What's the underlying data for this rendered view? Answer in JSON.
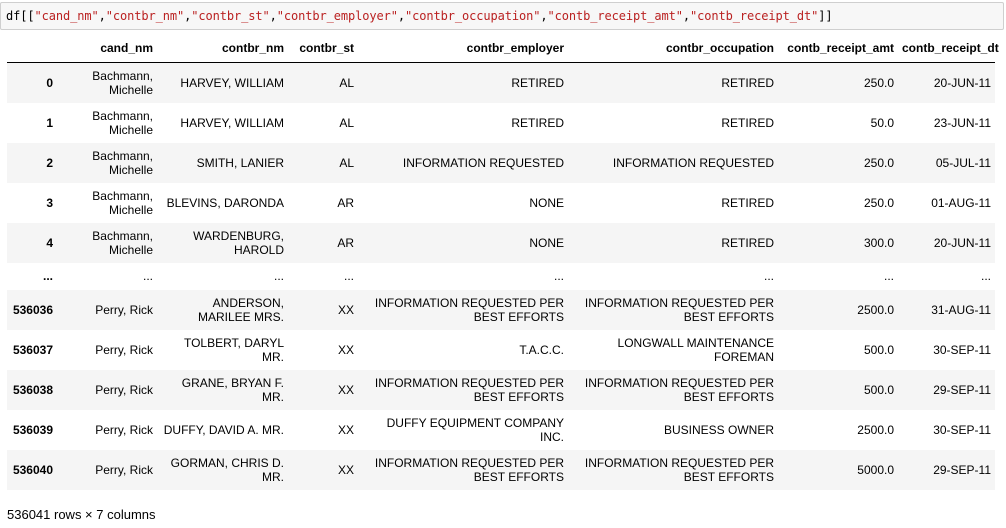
{
  "code": {
    "prefix": "df[[",
    "columns": [
      "\"cand_nm\"",
      "\"contbr_nm\"",
      "\"contbr_st\"",
      "\"contbr_employer\"",
      "\"contbr_occupation\"",
      "\"contb_receipt_amt\"",
      "\"contb_receipt_dt\""
    ],
    "separator": ",",
    "suffix": "]]"
  },
  "table": {
    "index_header": "",
    "headers": [
      "cand_nm",
      "contbr_nm",
      "contbr_st",
      "contbr_employer",
      "contbr_occupation",
      "contb_receipt_amt",
      "contb_receipt_dt"
    ],
    "rows": [
      {
        "index": "0",
        "cells": [
          "Bachmann, Michelle",
          "HARVEY, WILLIAM",
          "AL",
          "RETIRED",
          "RETIRED",
          "250.0",
          "20-JUN-11"
        ]
      },
      {
        "index": "1",
        "cells": [
          "Bachmann, Michelle",
          "HARVEY, WILLIAM",
          "AL",
          "RETIRED",
          "RETIRED",
          "50.0",
          "23-JUN-11"
        ]
      },
      {
        "index": "2",
        "cells": [
          "Bachmann, Michelle",
          "SMITH, LANIER",
          "AL",
          "INFORMATION REQUESTED",
          "INFORMATION REQUESTED",
          "250.0",
          "05-JUL-11"
        ]
      },
      {
        "index": "3",
        "cells": [
          "Bachmann, Michelle",
          "BLEVINS, DARONDA",
          "AR",
          "NONE",
          "RETIRED",
          "250.0",
          "01-AUG-11"
        ]
      },
      {
        "index": "4",
        "cells": [
          "Bachmann, Michelle",
          "WARDENBURG, HAROLD",
          "AR",
          "NONE",
          "RETIRED",
          "300.0",
          "20-JUN-11"
        ]
      },
      {
        "index": "...",
        "cells": [
          "...",
          "...",
          "...",
          "...",
          "...",
          "...",
          "..."
        ],
        "ellipsis": true
      },
      {
        "index": "536036",
        "cells": [
          "Perry, Rick",
          "ANDERSON, MARILEE MRS.",
          "XX",
          "INFORMATION REQUESTED PER BEST EFFORTS",
          "INFORMATION REQUESTED PER BEST EFFORTS",
          "2500.0",
          "31-AUG-11"
        ]
      },
      {
        "index": "536037",
        "cells": [
          "Perry, Rick",
          "TOLBERT, DARYL MR.",
          "XX",
          "T.A.C.C.",
          "LONGWALL MAINTENANCE FOREMAN",
          "500.0",
          "30-SEP-11"
        ]
      },
      {
        "index": "536038",
        "cells": [
          "Perry, Rick",
          "GRANE, BRYAN F. MR.",
          "XX",
          "INFORMATION REQUESTED PER BEST EFFORTS",
          "INFORMATION REQUESTED PER BEST EFFORTS",
          "500.0",
          "29-SEP-11"
        ]
      },
      {
        "index": "536039",
        "cells": [
          "Perry, Rick",
          "DUFFY, DAVID A. MR.",
          "XX",
          "DUFFY EQUIPMENT COMPANY INC.",
          "BUSINESS OWNER",
          "2500.0",
          "30-SEP-11"
        ]
      },
      {
        "index": "536040",
        "cells": [
          "Perry, Rick",
          "GORMAN, CHRIS D. MR.",
          "XX",
          "INFORMATION REQUESTED PER BEST EFFORTS",
          "INFORMATION REQUESTED PER BEST EFFORTS",
          "5000.0",
          "29-SEP-11"
        ]
      }
    ]
  },
  "summary": "536041 rows × 7 columns",
  "colors": {
    "string_literal": "#ba2121",
    "cell_background": "#f7f7f7",
    "row_stripe": "#f5f5f5"
  }
}
